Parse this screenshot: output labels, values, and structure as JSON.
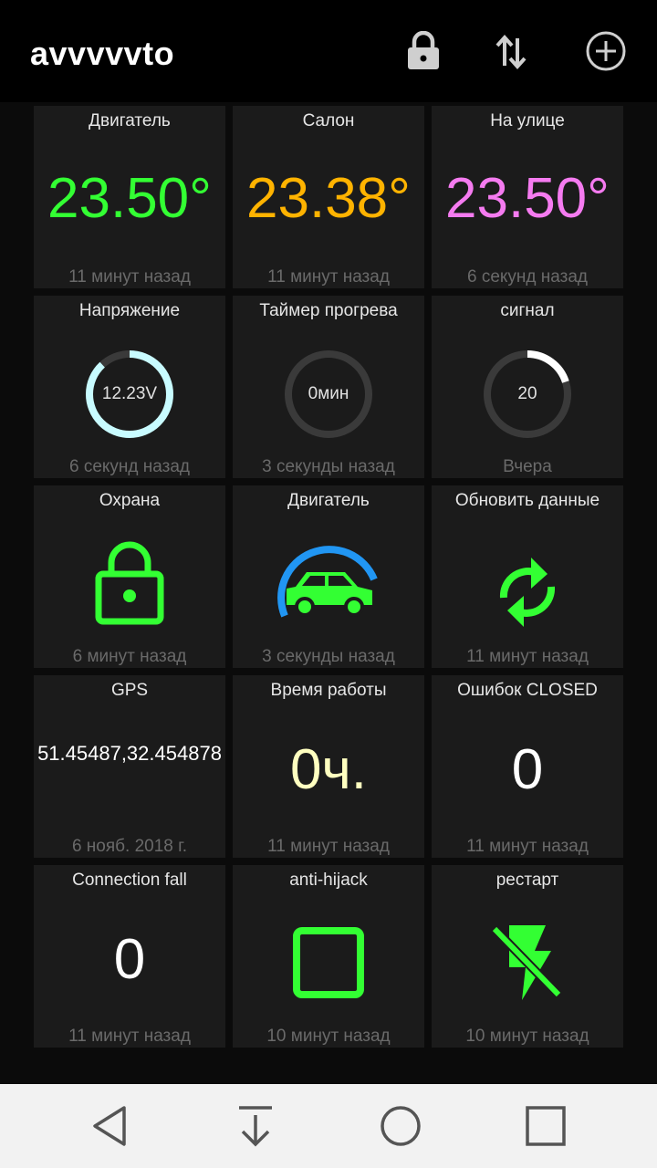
{
  "app": {
    "title": "avvvvvto",
    "actions": [
      {
        "name": "lock-icon"
      },
      {
        "name": "sort-arrows-icon"
      },
      {
        "name": "add-circle-icon"
      }
    ]
  },
  "colors": {
    "green": "#33ff33",
    "orange": "#ffb300",
    "pink": "#f57bf0",
    "cyan": "#c8fbff",
    "blue": "#2196f3",
    "cream": "#ffffc0",
    "white": "#ffffff"
  },
  "tiles": [
    {
      "title": "Двигатель",
      "value": "23.50°",
      "time": "11 минут назад"
    },
    {
      "title": "Салон",
      "value": "23.38°",
      "time": "11 минут назад"
    },
    {
      "title": "На улице",
      "value": "23.50°",
      "time": "6 секунд назад"
    },
    {
      "title": "Напряжение",
      "value": "12.23V",
      "gauge_fraction": 0.88,
      "time": "6 секунд назад"
    },
    {
      "title": "Таймер прогрева",
      "value": "0мин",
      "gauge_fraction": 0,
      "time": "3 секунды назад"
    },
    {
      "title": "сигнал",
      "value": "20",
      "gauge_fraction": 0.2,
      "time": "Вчера"
    },
    {
      "title": "Охрана",
      "icon": "padlock-icon",
      "time": "6 минут назад"
    },
    {
      "title": "Двигатель",
      "icon": "car-engine-icon",
      "time": "3 секунды назад"
    },
    {
      "title": "Обновить данные",
      "icon": "refresh-icon",
      "time": "11 минут назад"
    },
    {
      "title": "GPS",
      "value": "51.45487,32.454878",
      "time": "6 нояб. 2018 г."
    },
    {
      "title": "Время работы",
      "value": "0ч.",
      "time": "11 минут назад"
    },
    {
      "title": "Ошибок CLOSED",
      "value": "0",
      "time": "11 минут назад"
    },
    {
      "title": "Connection fall",
      "value": "0",
      "time": "11 минут назад"
    },
    {
      "title": "anti-hijack",
      "icon": "checkbox-square-icon",
      "time": "10 минут назад"
    },
    {
      "title": "рестарт",
      "icon": "flash-off-icon",
      "time": "10 минут назад"
    }
  ],
  "navbar": [
    {
      "name": "back-icon"
    },
    {
      "name": "download-arrow-icon"
    },
    {
      "name": "home-circle-icon"
    },
    {
      "name": "recents-square-icon"
    }
  ]
}
